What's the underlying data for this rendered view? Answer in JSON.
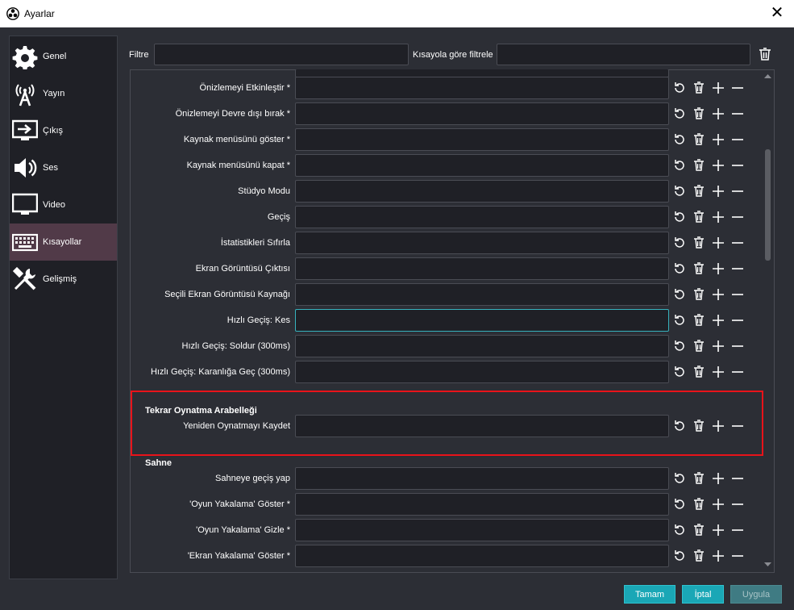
{
  "window": {
    "title": "Ayarlar"
  },
  "sidebar": {
    "items": [
      {
        "label": "Genel",
        "icon": "gear-icon",
        "active": false
      },
      {
        "label": "Yayın",
        "icon": "broadcast-antenna-icon",
        "active": false
      },
      {
        "label": "Çıkış",
        "icon": "output-monitor-icon",
        "active": false
      },
      {
        "label": "Ses",
        "icon": "speaker-icon",
        "active": false
      },
      {
        "label": "Video",
        "icon": "monitor-icon",
        "active": false
      },
      {
        "label": "Kısayollar",
        "icon": "keyboard-icon",
        "active": true
      },
      {
        "label": "Gelişmiş",
        "icon": "tools-icon",
        "active": false
      }
    ]
  },
  "filters": {
    "filter_label": "Filtre",
    "filter_value": "",
    "shortcut_filter_label": "Kısayola göre filtrele",
    "shortcut_filter_value": ""
  },
  "hotkeys": {
    "rows_top": [
      {
        "label": "Önizlemeyi Etkinleştir *",
        "value": ""
      },
      {
        "label": "Önizlemeyi Devre dışı bırak *",
        "value": ""
      },
      {
        "label": "Kaynak menüsünü göster *",
        "value": ""
      },
      {
        "label": "Kaynak menüsünü kapat *",
        "value": ""
      },
      {
        "label": "Stüdyo Modu",
        "value": ""
      },
      {
        "label": "Geçiş",
        "value": ""
      },
      {
        "label": "İstatistikleri Sıfırla",
        "value": ""
      },
      {
        "label": "Ekran Görüntüsü Çıktısı",
        "value": ""
      },
      {
        "label": "Seçili Ekran Görüntüsü Kaynağı",
        "value": ""
      },
      {
        "label": "Hızlı Geçiş: Kes",
        "value": ""
      },
      {
        "label": "Hızlı Geçiş: Soldur (300ms)",
        "value": ""
      },
      {
        "label": "Hızlı Geçiş: Karanlığa Geç (300ms)",
        "value": ""
      }
    ],
    "replay_section": {
      "title": "Tekrar Oynatma Arabelleği",
      "rows": [
        {
          "label": "Yeniden Oynatmayı Kaydet",
          "value": ""
        }
      ]
    },
    "scene_section": {
      "title": "Sahne",
      "rows": [
        {
          "label": "Sahneye geçiş yap",
          "value": ""
        },
        {
          "label": "'Oyun Yakalama' Göster *",
          "value": ""
        },
        {
          "label": "'Oyun Yakalama' Gizle *",
          "value": ""
        },
        {
          "label": "'Ekran Yakalama' Göster *",
          "value": ""
        }
      ]
    }
  },
  "buttons": {
    "ok": "Tamam",
    "cancel": "İptal",
    "apply": "Uygula"
  },
  "colors": {
    "accent": "#1aa7b6",
    "active_sidebar": "#513a48",
    "highlight": "#e8131a",
    "focus": "#36b2bd"
  }
}
